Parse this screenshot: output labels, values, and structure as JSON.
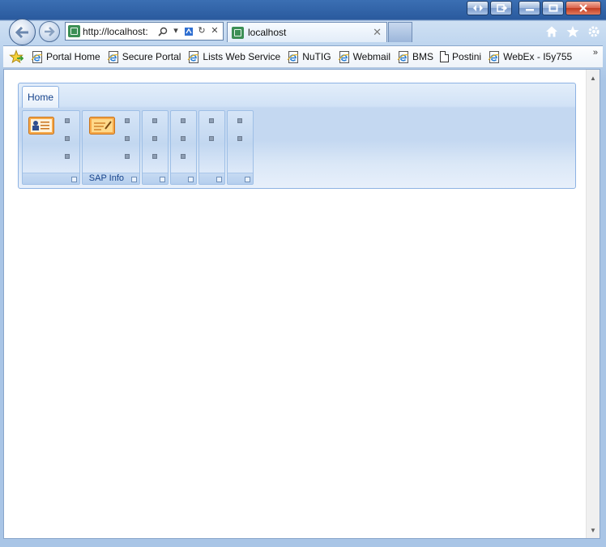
{
  "browser": {
    "address_url": "http://localhost:",
    "tab_title": "localhost",
    "icons": [
      "back-icon",
      "forward-icon",
      "search-icon",
      "dropdown-icon",
      "compatibility-icon",
      "refresh-icon",
      "stop-icon",
      "home-icon",
      "favorites-icon",
      "tools-icon"
    ]
  },
  "favorites": {
    "items": [
      {
        "label": "Portal Home",
        "icon": "ie-page-icon"
      },
      {
        "label": "Secure Portal",
        "icon": "ie-page-icon"
      },
      {
        "label": "Lists Web Service",
        "icon": "ie-page-icon"
      },
      {
        "label": "NuTIG",
        "icon": "ie-page-icon"
      },
      {
        "label": "Webmail",
        "icon": "ie-page-icon"
      },
      {
        "label": "BMS",
        "icon": "ie-page-icon"
      },
      {
        "label": "Postini",
        "icon": "blank-page-icon"
      },
      {
        "label": "WebEx - I5y755",
        "icon": "ie-page-icon"
      }
    ],
    "more": "»"
  },
  "ribbon": {
    "tabs": [
      {
        "label": "Home"
      }
    ],
    "groups": [
      {
        "caption": "",
        "icon": "contact-card-icon"
      },
      {
        "caption": "SAP Info",
        "icon": "notepad-icon"
      },
      {
        "caption": ""
      },
      {
        "caption": ""
      },
      {
        "caption": ""
      },
      {
        "caption": ""
      }
    ]
  },
  "colors": {
    "ribbon_text": "#15428b",
    "ribbon_border": "#8db2e3",
    "window_frame": "#2a5a9e"
  }
}
